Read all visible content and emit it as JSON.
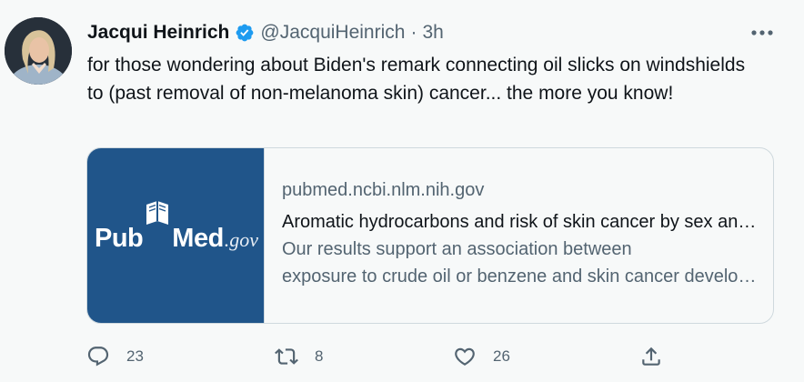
{
  "author": {
    "name": "Jacqui Heinrich",
    "handle": "@JacquiHeinrich",
    "time": "3h",
    "separator": "·"
  },
  "tweet": {
    "text": "for those wondering about Biden's remark connecting oil slicks on windshields to (past removal of non-melanoma skin) cancer... the more you know!"
  },
  "card": {
    "logo": {
      "pub": "Pub",
      "med": "Med",
      "gov": ".gov"
    },
    "domain": "pubmed.ncbi.nlm.nih.gov",
    "title": "Aromatic hydrocarbons and risk of skin cancer by sex and anatomic location: a population-based study",
    "description_line1": "Our results support an association between",
    "description_line2": "exposure to crude oil or benzene and skin cancer development"
  },
  "actions": {
    "reply_count": "23",
    "retweet_count": "8",
    "like_count": "26"
  },
  "icons": {
    "verified": "verified-badge-icon",
    "more": "more-horizontal-icon",
    "reply": "reply-icon",
    "retweet": "retweet-icon",
    "like": "heart-icon",
    "share": "share-icon"
  },
  "colors": {
    "background": "#f7f9f9",
    "verified_blue": "#1d9bf0",
    "pubmed_blue": "#20558a",
    "secondary_text": "#536471"
  }
}
